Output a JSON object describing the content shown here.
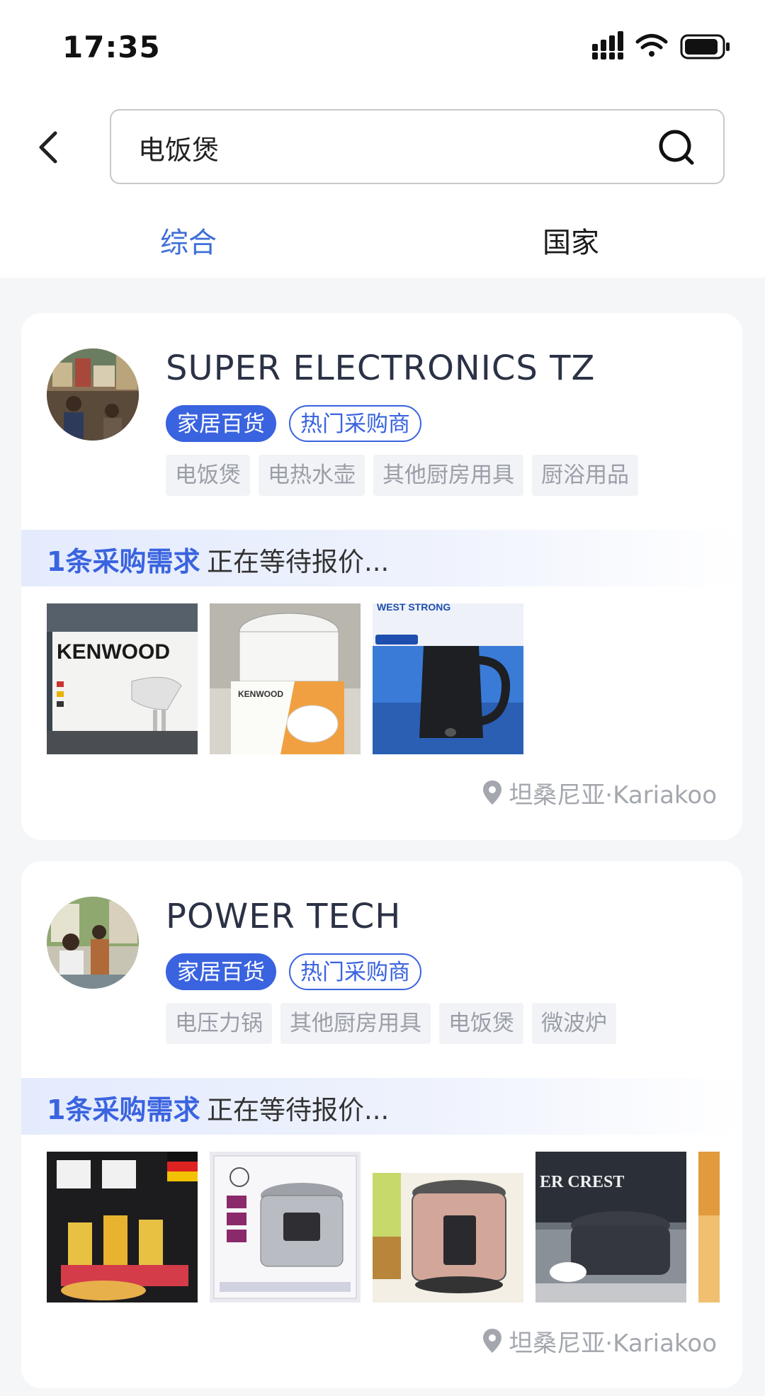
{
  "status_bar": {
    "time": "17:35"
  },
  "search": {
    "query": "电饭煲"
  },
  "tabs": [
    {
      "label": "综合",
      "active": true
    },
    {
      "label": "国家",
      "active": false
    }
  ],
  "colors": {
    "accent": "#3a63df",
    "active_tab": "#3f6fd8",
    "tag_bg": "#f2f3f6",
    "tag_text": "#9a9ea8"
  },
  "results": [
    {
      "company": "SUPER ELECTRONICS TZ",
      "badges": [
        "家居百货",
        "热门采购商"
      ],
      "tags": [
        "电饭煲",
        "电热水壶",
        "其他厨房用具",
        "厨浴用品"
      ],
      "demand_count": "1条采购需求",
      "demand_status": "正在等待报价...",
      "thumbnails": [
        {
          "name": "kenwood-hand-mixer-box",
          "text": "KENWOOD"
        },
        {
          "name": "kenwood-rice-cooker-box",
          "text": "KENWOOD"
        },
        {
          "name": "west-strong-kettle-box",
          "text": "WEST STRONG"
        }
      ],
      "location": "坦桑尼亚·Kariakoo"
    },
    {
      "company": "POWER TECH",
      "badges": [
        "家居百货",
        "热门采购商"
      ],
      "tags": [
        "电压力锅",
        "其他厨房用具",
        "电饭煲",
        "微波炉"
      ],
      "demand_count": "1条采购需求",
      "demand_status": "正在等待报价...",
      "thumbnails": [
        {
          "name": "blender-boxes"
        },
        {
          "name": "pressure-cooker-box"
        },
        {
          "name": "sukopp-pressure-cooker"
        },
        {
          "name": "rice-cooker-box",
          "text": "ER CREST"
        },
        {
          "name": "partial-product"
        }
      ],
      "location": "坦桑尼亚·Kariakoo"
    }
  ]
}
